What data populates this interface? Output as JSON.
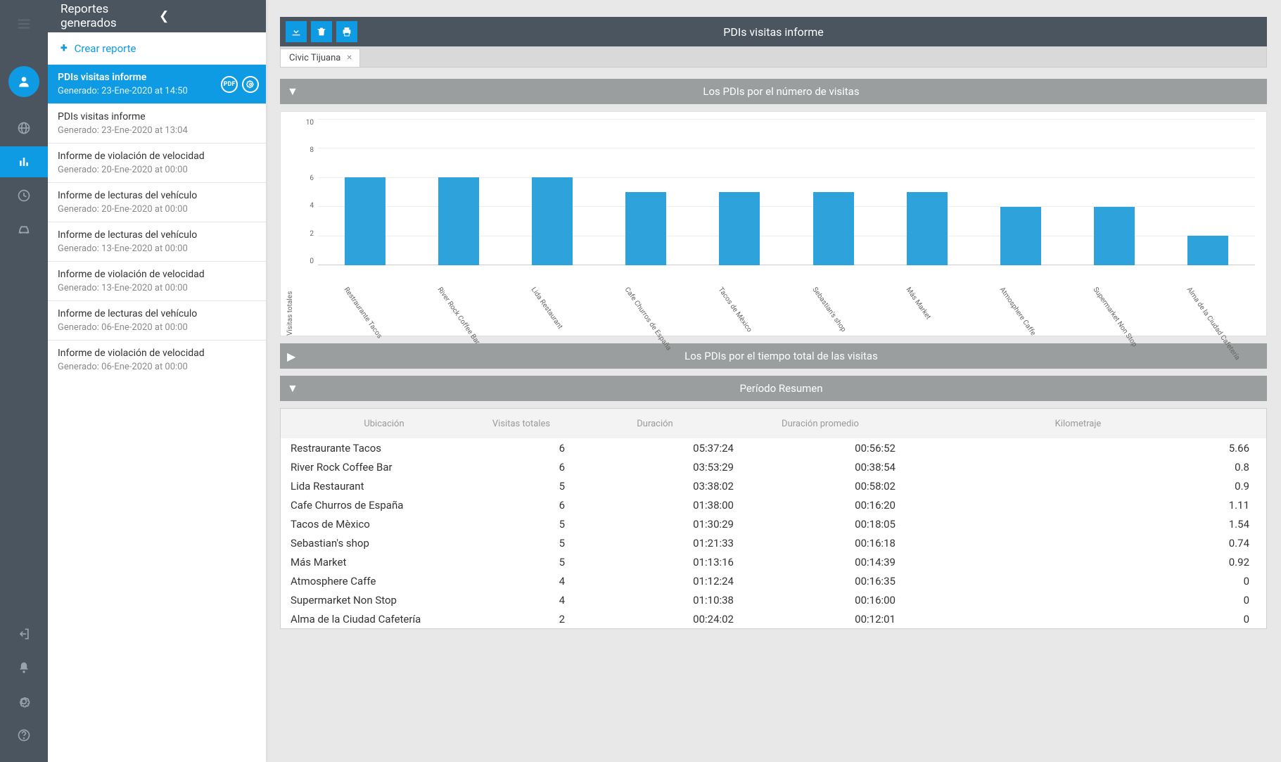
{
  "sidebar_header": "Reportes generados",
  "create_label": "Crear reporte",
  "reports": [
    {
      "title": "PDIs visitas informe",
      "sub": "Generado: 23-Ene-2020 at 14:50",
      "active": true
    },
    {
      "title": "PDIs visitas informe",
      "sub": "Generado: 23-Ene-2020 at 13:04"
    },
    {
      "title": "Informe de violación de velocidad",
      "sub": "Generado: 20-Ene-2020 at 00:00"
    },
    {
      "title": "Informe de lecturas del vehículo",
      "sub": "Generado: 20-Ene-2020 at 00:00"
    },
    {
      "title": "Informe de lecturas del vehículo",
      "sub": "Generado: 13-Ene-2020 at 00:00"
    },
    {
      "title": "Informe de violación de velocidad",
      "sub": "Generado: 13-Ene-2020 at 00:00"
    },
    {
      "title": "Informe de lecturas del vehículo",
      "sub": "Generado: 06-Ene-2020 at 00:00"
    },
    {
      "title": "Informe de violación de velocidad",
      "sub": "Generado: 06-Ene-2020 at 00:00"
    }
  ],
  "toolbar_title": "PDIs visitas informe",
  "tab_label": "Civic Tijuana",
  "section1_title": "Los PDIs por el número de visitas",
  "section2_title": "Los PDIs por el tiempo total de las visitas",
  "section3_title": "Período Resumen",
  "pdf_label": "PDF",
  "chart_data": {
    "type": "bar",
    "ylabel": "Visitas totales",
    "ylim": [
      0,
      10
    ],
    "y_ticks": [
      10,
      8,
      6,
      4,
      2,
      0
    ],
    "categories": [
      "Restraurante Tacos",
      "River Rock Coffee Bar",
      "Lida Restaurant",
      "Cafe Churros de España",
      "Tacos de Mèxico",
      "Sebastian's shop",
      "Más Market",
      "Atmosphere Caffe",
      "Supermarket Non Stop",
      "Alma de la Ciudad Cafetería"
    ],
    "values": [
      6,
      6,
      6,
      5,
      5,
      5,
      5,
      4,
      4,
      2
    ]
  },
  "table": {
    "headers": [
      "Ubicación",
      "Visitas totales",
      "Duración",
      "Duración promedio",
      "Kilometraje"
    ],
    "rows": [
      [
        "Restraurante Tacos",
        "6",
        "05:37:24",
        "00:56:52",
        "5.66"
      ],
      [
        "River Rock Coffee Bar",
        "6",
        "03:53:29",
        "00:38:54",
        "0.8"
      ],
      [
        "Lida Restaurant",
        "5",
        "03:38:02",
        "00:58:02",
        "0.9"
      ],
      [
        "Cafe Churros de España",
        "6",
        "01:38:00",
        "00:16:20",
        "1.11"
      ],
      [
        "Tacos de Mèxico",
        "5",
        "01:30:29",
        "00:18:05",
        "1.54"
      ],
      [
        "Sebastian's shop",
        "5",
        "01:21:33",
        "00:16:18",
        "0.74"
      ],
      [
        "Más Market",
        "5",
        "01:13:16",
        "00:14:39",
        "0.92"
      ],
      [
        "Atmosphere Caffe",
        "4",
        "01:12:24",
        "00:16:35",
        "0"
      ],
      [
        "Supermarket Non Stop",
        "4",
        "01:10:38",
        "00:16:00",
        "0"
      ],
      [
        "Alma de la Ciudad Cafetería",
        "2",
        "00:24:02",
        "00:12:01",
        "0"
      ]
    ]
  }
}
